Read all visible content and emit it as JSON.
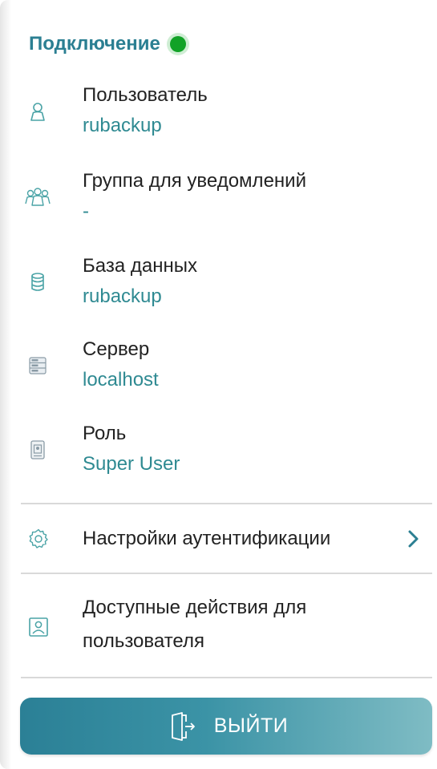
{
  "header": {
    "title": "Подключение",
    "status": "connected",
    "status_color": "#12a227"
  },
  "info": [
    {
      "label": "Пользователь",
      "value": "rubackup",
      "icon": "user-icon"
    },
    {
      "label": "Группа для уведомлений",
      "value": "-",
      "icon": "users-group-icon"
    },
    {
      "label": "База данных",
      "value": "rubackup",
      "icon": "database-icon"
    },
    {
      "label": "Сервер",
      "value": "localhost",
      "icon": "server-icon"
    },
    {
      "label": "Роль",
      "value": "Super User",
      "icon": "role-badge-icon"
    }
  ],
  "menu": {
    "auth_settings": {
      "label": "Настройки аутентификации",
      "icon": "gear-icon"
    },
    "user_actions": {
      "label_line1": "Доступные действия для",
      "label_line2": "пользователя",
      "icon": "user-card-icon"
    }
  },
  "logout": {
    "label": "ВЫЙТИ",
    "icon": "exit-door-icon"
  },
  "colors": {
    "accent": "#2b7f92",
    "value_text": "#2f8a92",
    "icon_stroke": "#4aa3a6",
    "button_gradient_start": "#2b8096",
    "button_gradient_end": "#7fbcc4"
  }
}
